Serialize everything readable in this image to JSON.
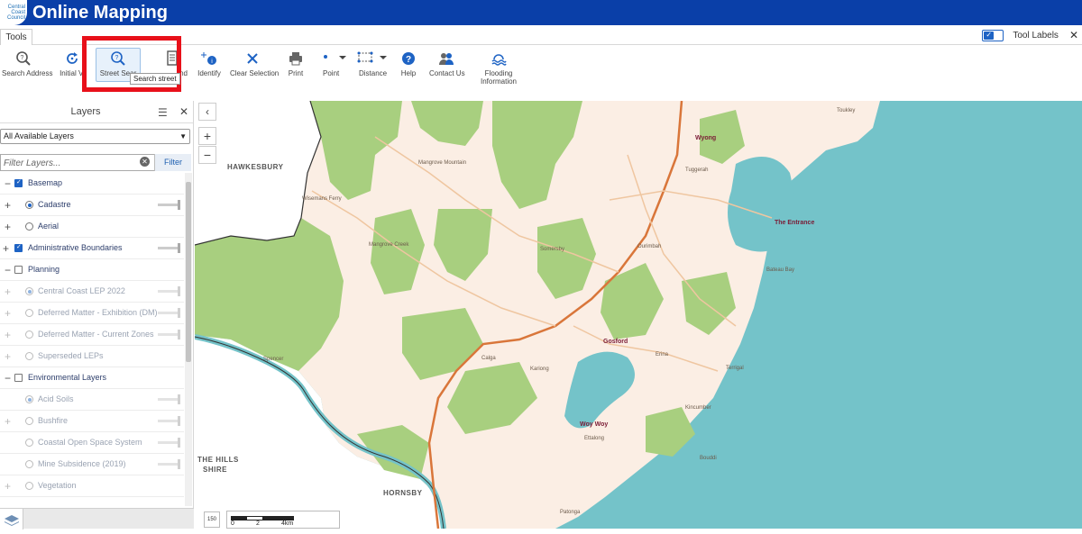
{
  "header": {
    "logo_lines": [
      "Central",
      "Coast",
      "Council"
    ],
    "title": "Online Mapping"
  },
  "tools_strip": {
    "tab_label": "Tools",
    "tool_labels_text": "Tool Labels",
    "tool_labels_on": true
  },
  "toolbar": {
    "items": [
      {
        "label": "Search Address",
        "icon": "search-address-icon"
      },
      {
        "label": "Initial View",
        "icon": "refresh-icon"
      },
      {
        "label": "Street Search",
        "icon": "street-search-icon"
      },
      {
        "label": "Land",
        "icon": "land-icon"
      },
      {
        "label": "Identify",
        "icon": "identify-icon"
      },
      {
        "label": "Clear Selection",
        "icon": "close-icon"
      },
      {
        "label": "Print",
        "icon": "printer-icon"
      },
      {
        "label": "Point",
        "icon": "point-icon"
      },
      {
        "label": "Distance",
        "icon": "distance-icon"
      },
      {
        "label": "Help",
        "icon": "help-icon"
      },
      {
        "label": "Contact Us",
        "icon": "people-icon"
      },
      {
        "label": "Flooding Information",
        "label_line1": "Flooding",
        "label_line2": "Information",
        "icon": "flood-icon"
      }
    ],
    "initial_view_shown": "Initial Vi",
    "street_search_shown": "Street Sear",
    "land_shown": "nd",
    "tooltip": "Search street",
    "highlight_color": "#e8101a"
  },
  "layers_panel": {
    "title": "Layers",
    "dropdown_value": "All Available Layers",
    "filter_placeholder": "Filter Layers...",
    "filter_button": "Filter",
    "rows": [
      {
        "label": "Basemap",
        "type": "group",
        "checked": true,
        "dim": false
      },
      {
        "label": "Cadastre",
        "type": "radio",
        "checked": true,
        "dim": false
      },
      {
        "label": "Aerial",
        "type": "radio",
        "checked": false,
        "dim": false
      },
      {
        "label": "Administrative Boundaries",
        "type": "group",
        "checked": true,
        "dim": false
      },
      {
        "label": "Planning",
        "type": "group",
        "checked": false,
        "dim": false
      },
      {
        "label": "Central Coast LEP 2022",
        "type": "radio",
        "checked": true,
        "dim": true
      },
      {
        "label": "Deferred Matter - Exhibition (DM)",
        "type": "radio",
        "checked": false,
        "dim": true
      },
      {
        "label": "Deferred Matter - Current Zones",
        "type": "radio",
        "checked": false,
        "dim": true
      },
      {
        "label": "Superseded LEPs",
        "type": "radio",
        "checked": false,
        "dim": true
      },
      {
        "label": "Environmental Layers",
        "type": "group",
        "checked": false,
        "dim": false
      },
      {
        "label": "Acid Soils",
        "type": "radio",
        "checked": true,
        "dim": true
      },
      {
        "label": "Bushfire",
        "type": "radio",
        "checked": false,
        "dim": true
      },
      {
        "label": "Coastal Open Space System",
        "type": "radio",
        "checked": false,
        "dim": true
      },
      {
        "label": "Mine Subsidence (2019)",
        "type": "radio",
        "checked": false,
        "dim": true
      },
      {
        "label": "Vegetation",
        "type": "radio",
        "checked": false,
        "dim": true
      }
    ]
  },
  "map": {
    "region_labels": [
      "HAWKESBURY",
      "THE HILLS",
      "SHIRE",
      "HORNSBY"
    ],
    "town_labels": [
      "Wyong",
      "The Entrance",
      "Gosford",
      "Woy Woy",
      "Mangrove Mountain",
      "Somersby",
      "Ourimbah",
      "Terrigal",
      "Toukley",
      "Bateau Bay",
      "Erina",
      "Kariong",
      "Calga",
      "Bouddi",
      "Patonga",
      "Mangrove Creek",
      "Spencer",
      "Wisemans Ferry",
      "Tuggerah",
      "Kincumber",
      "Ettalong"
    ],
    "zoom_in": "+",
    "zoom_out": "−",
    "scale_labels": [
      "0",
      "2",
      "4km"
    ],
    "overview_label": "150",
    "colors": {
      "water": "#74c3c9",
      "land": "#fbeee4",
      "forest": "#a8cf7f",
      "road_major": "#d9763a",
      "road_minor": "#efc6a0"
    }
  }
}
